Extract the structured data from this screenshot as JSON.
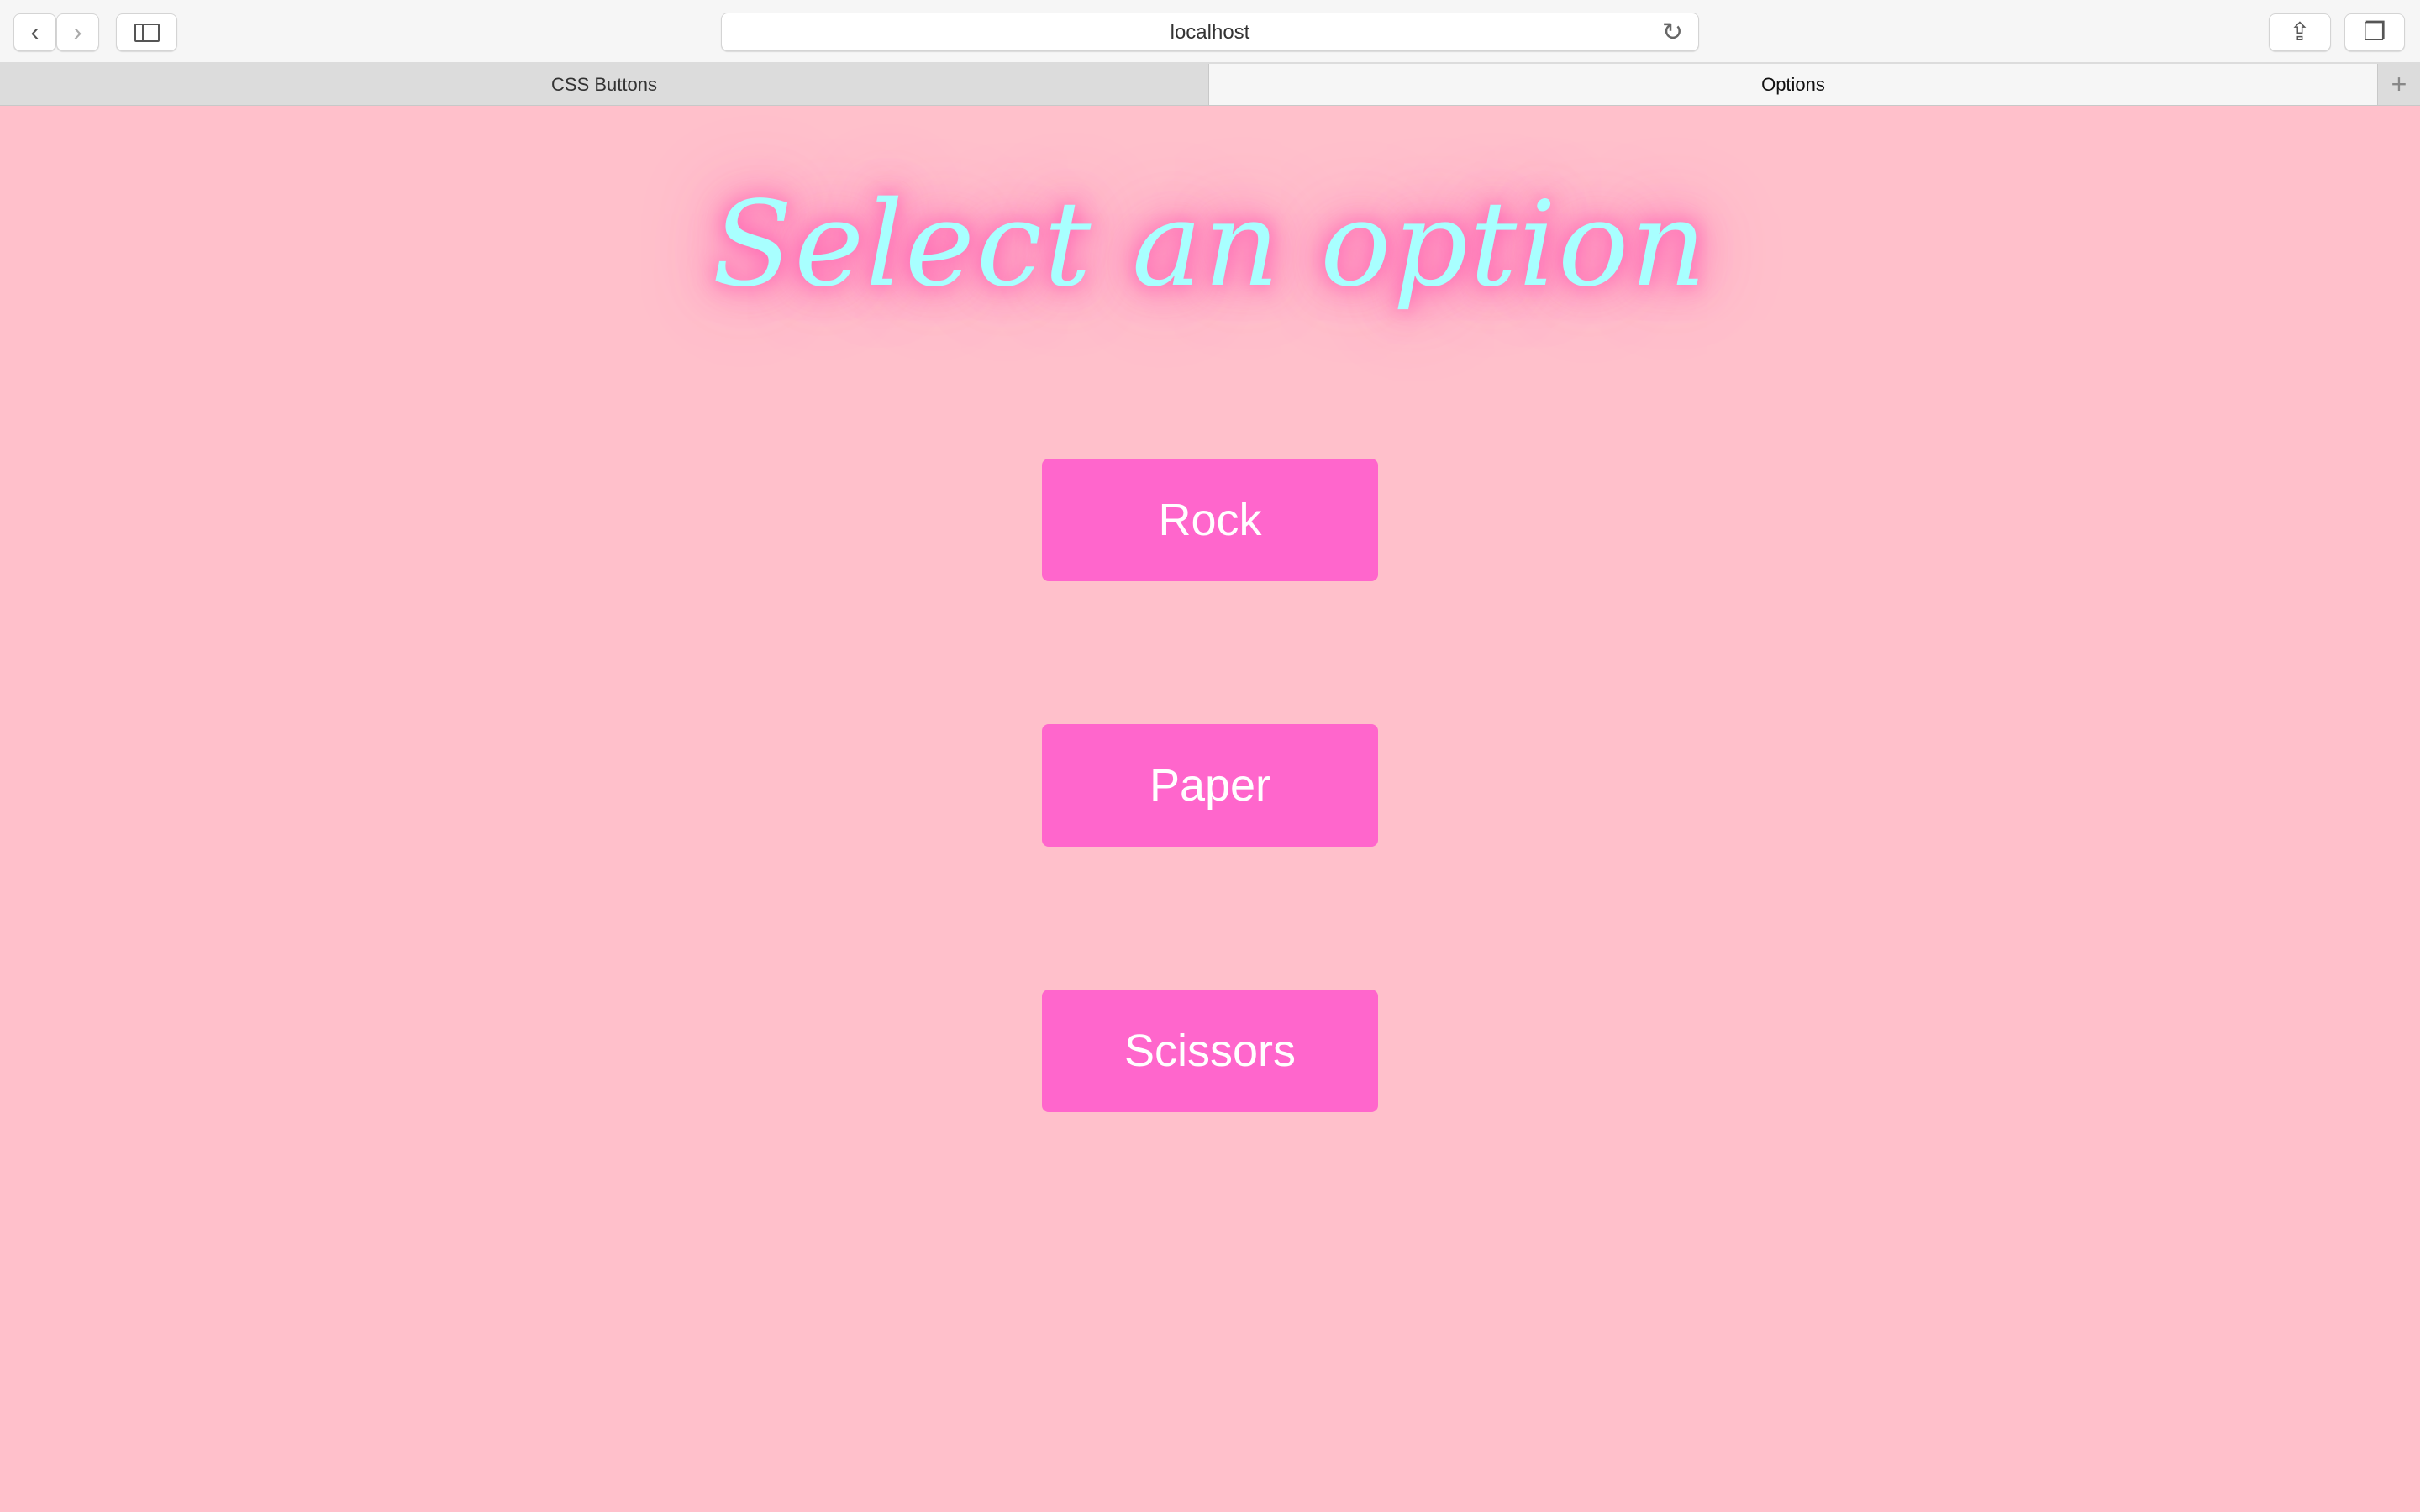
{
  "browser": {
    "url": "localhost",
    "tabs": [
      {
        "label": "CSS Buttons",
        "active": false
      },
      {
        "label": "Options",
        "active": true
      }
    ]
  },
  "page": {
    "title": "Select an option",
    "options": [
      "Rock",
      "Paper",
      "Scissors"
    ]
  },
  "colors": {
    "background": "#ffc0cb",
    "button": "#ff66cc",
    "title_text": "#a8ffff",
    "title_glow": "#ff69b4"
  }
}
